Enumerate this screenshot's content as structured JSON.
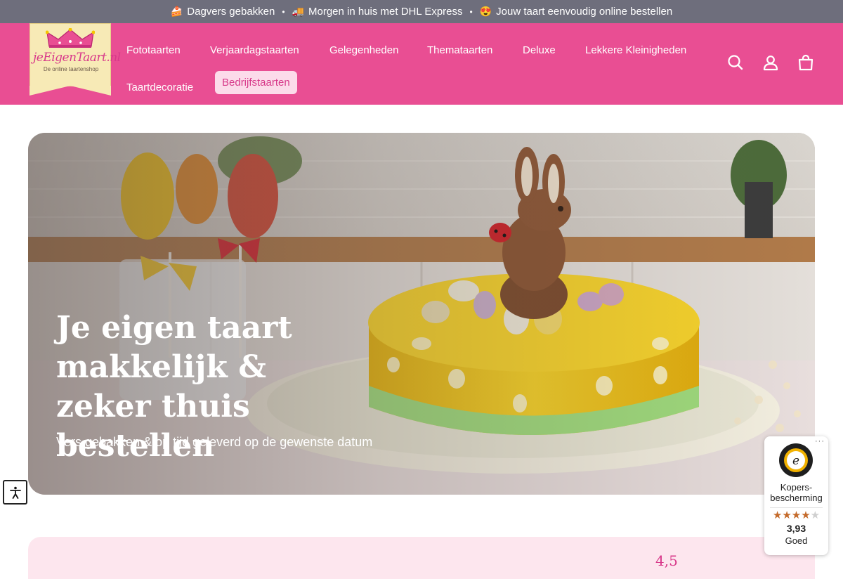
{
  "announcement": {
    "items": [
      {
        "emoji": "🍰",
        "text": "Dagvers gebakken"
      },
      {
        "emoji": "🚚",
        "text": "Morgen in huis met DHL Express"
      },
      {
        "emoji": "😍",
        "text": "Jouw taart eenvoudig online bestellen"
      }
    ],
    "separator": "•"
  },
  "logo": {
    "wordmark": "jeEigenTaart.nl",
    "tagline": "De online taartenshop"
  },
  "nav": {
    "items": [
      {
        "label": "Fototaarten"
      },
      {
        "label": "Verjaardagstaarten"
      },
      {
        "label": "Gelegenheden"
      },
      {
        "label": "Themataarten"
      },
      {
        "label": "Deluxe"
      },
      {
        "label": "Lekkere Kleinigheden"
      },
      {
        "label": "Taartdecoratie"
      },
      {
        "label": "Bedrijfstaarten",
        "active": true
      }
    ]
  },
  "header_icons": [
    "search-icon",
    "account-icon",
    "cart-icon"
  ],
  "hero": {
    "title": "Je eigen taart makkelijk & zeker thuis bestellen",
    "subtitle": "Vers gebakken & op tijd geleverd op de gewenste datum"
  },
  "accessibility": {
    "icon": "accessibility-icon"
  },
  "bottom_section": {
    "partial_number": "4,5"
  },
  "trusted_shops": {
    "menu": "···",
    "label": "Kopers-bescherming",
    "rating_value": 3.93,
    "score": "3,93",
    "rating_text": "Goed",
    "stars_total": 5,
    "stars_filled": 4
  },
  "colors": {
    "brand_pink": "#e94e93",
    "announcement_bg": "#6e6e7c",
    "active_nav_bg": "#fcdbea",
    "star": "#c46a2a"
  }
}
